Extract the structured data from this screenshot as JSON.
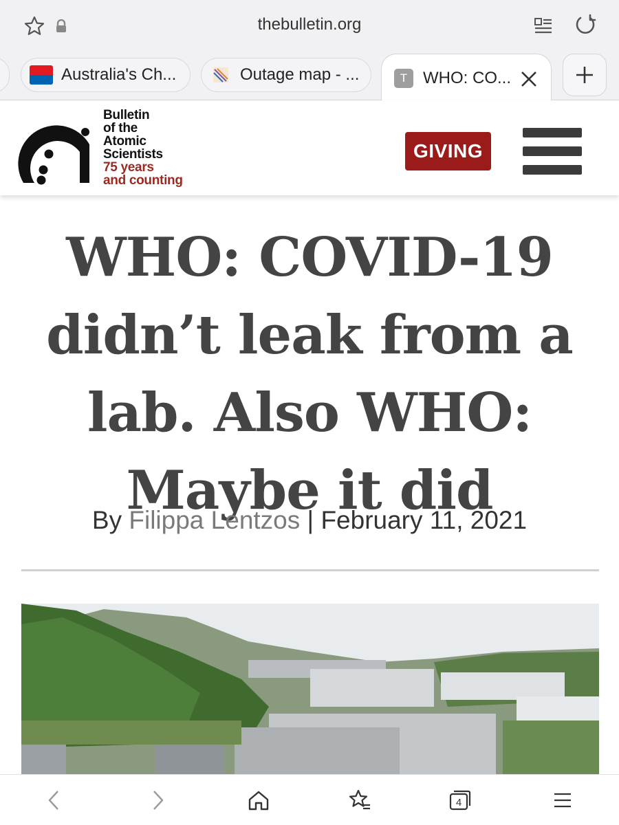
{
  "browser": {
    "url": "thebulletin.org",
    "tabs": [
      {
        "title": "Australia's Ch...",
        "favicon": "chemist-warehouse-icon"
      },
      {
        "title": "Outage map - ...",
        "favicon": "outage-map-icon"
      },
      {
        "title": "WHO: CO...",
        "favicon": "T",
        "active": true
      }
    ],
    "tab_count": "4"
  },
  "site": {
    "logo_lines": [
      "Bulletin",
      "of the",
      "Atomic",
      "Scientists"
    ],
    "logo_tagline": [
      "75 years",
      "and counting"
    ],
    "giving_label": "GIVING",
    "brand_red": "#9b1b1b"
  },
  "article": {
    "headline": "WHO: COVID-19 didn’t leak from a lab. Also WHO: Maybe it did",
    "by_prefix": "By",
    "author": "Filippa Lentzos",
    "separator": "|",
    "date": "February 11, 2021"
  },
  "nav": {
    "icons": [
      "back-icon",
      "forward-icon",
      "home-icon",
      "bookmarks-icon",
      "tabs-icon",
      "menu-icon"
    ]
  }
}
